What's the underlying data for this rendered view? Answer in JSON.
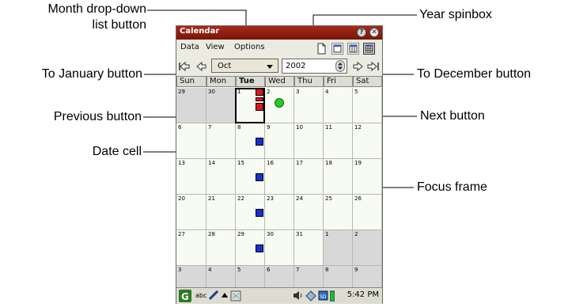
{
  "callouts": {
    "month_dropdown_line1": "Month drop-down",
    "month_dropdown_line2": "list button",
    "year_spinbox": "Year spinbox",
    "to_january": "To January button",
    "to_december": "To December button",
    "previous": "Previous button",
    "next": "Next button",
    "date_cell": "Date cell",
    "focus_frame": "Focus frame"
  },
  "window": {
    "title": "Calendar",
    "help_glyph": "?",
    "close_glyph": "✕"
  },
  "menu": {
    "items": [
      "Data",
      "View",
      "Options"
    ]
  },
  "toolbar": {
    "month_value": "Oct",
    "year_value": "2002"
  },
  "calendar": {
    "day_headers": [
      "Sun",
      "Mon",
      "Tue",
      "Wed",
      "Thu",
      "Fri",
      "Sat"
    ],
    "highlight_day": "Tue",
    "weeks": [
      [
        "29",
        "30",
        "1",
        "2",
        "3",
        "4",
        "5"
      ],
      [
        "6",
        "7",
        "8",
        "9",
        "10",
        "11",
        "12"
      ],
      [
        "13",
        "14",
        "15",
        "16",
        "17",
        "18",
        "19"
      ],
      [
        "20",
        "21",
        "22",
        "23",
        "24",
        "25",
        "26"
      ],
      [
        "27",
        "28",
        "29",
        "30",
        "31",
        "1",
        "2"
      ],
      [
        "3",
        "4",
        "5",
        "6",
        "7",
        "8",
        "9"
      ]
    ]
  },
  "taskbar": {
    "input_mode": "abc",
    "clock": "5:42 PM"
  },
  "colors": {
    "titlebar": "#8b1a0c",
    "event_blue": "#1a2fd0",
    "event_red": "#e01818",
    "event_green": "#22cc22",
    "other_month_cell": "#d8d8d8",
    "current_month_cell": "#f7fbf2"
  }
}
